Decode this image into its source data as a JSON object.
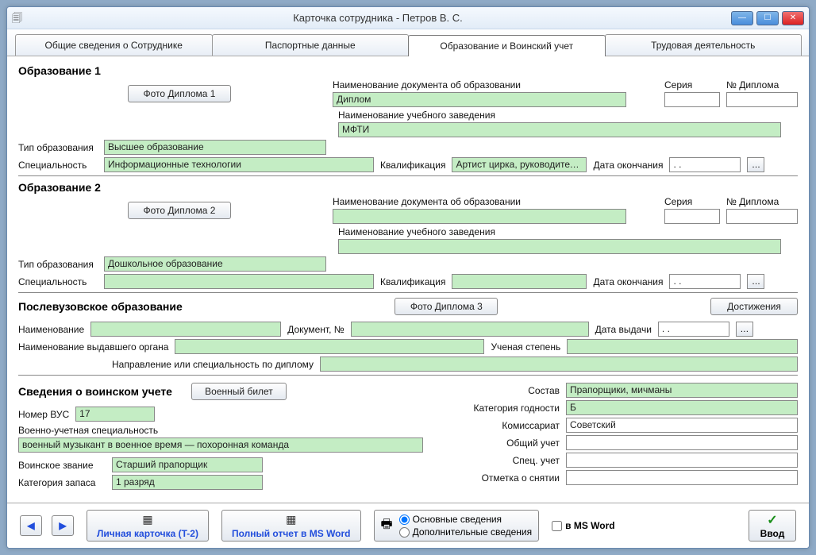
{
  "window": {
    "title": "Карточка сотрудника -  Петров В. С."
  },
  "tabs": {
    "t1": "Общие сведения о Сотруднике",
    "t2": "Паспортные данные",
    "t3": "Образование и Воинский учет",
    "t4": "Трудовая деятельность"
  },
  "edu1": {
    "head": "Образование 1",
    "photo_btn": "Фото Диплома 1",
    "doc_label": "Наименование документа об образовании",
    "doc_value": "Диплом",
    "series_label": "Серия",
    "number_label": "№ Диплома",
    "series_value": "",
    "number_value": "",
    "inst_label": "Наименование учебного заведения",
    "inst_value": "МФТИ",
    "type_label": "Тип образования",
    "type_value": "Высшее образование",
    "spec_label": "Специальность",
    "spec_value": "Информационные технологии",
    "qual_label": "Квалификация",
    "qual_value": "Артист цирка, руководитель и",
    "end_label": "Дата окончания",
    "end_value": " .  ."
  },
  "edu2": {
    "head": "Образование 2",
    "photo_btn": "Фото Диплома 2",
    "doc_label": "Наименование документа об образовании",
    "doc_value": "",
    "series_label": "Серия",
    "number_label": "№ Диплома",
    "series_value": "",
    "number_value": "",
    "inst_label": "Наименование учебного заведения",
    "inst_value": "",
    "type_label": "Тип образования",
    "type_value": "Дошкольное образование",
    "spec_label": "Специальность",
    "spec_value": "",
    "qual_label": "Квалификация",
    "qual_value": "",
    "end_label": "Дата окончания",
    "end_value": " .  ."
  },
  "post": {
    "head": "Послевузовское образование",
    "photo_btn": "Фото Диплома 3",
    "ach_btn": "Достижения",
    "name_label": "Наименование",
    "name_value": "",
    "docnum_label": "Документ, №",
    "docnum_value": "",
    "issue_label": "Дата выдачи",
    "issue_value": " .  .",
    "organ_label": "Наименование выдавшего органа",
    "organ_value": "",
    "degree_label": "Ученая степень",
    "degree_value": "",
    "dir_label": "Направление или специальность по диплому",
    "dir_value": ""
  },
  "mil": {
    "head": "Сведения о воинском учете",
    "ticket_btn": "Военный билет",
    "vus_label": "Номер ВУС",
    "vus_value": "17",
    "vusspec_label": "Военно-учетная специальность",
    "vusspec_value": "военный музыкант в военное время — похоронная команда",
    "rank_label": "Воинское звание",
    "rank_value": "Старший прапорщик",
    "reserve_label": "Категория запаса",
    "reserve_value": "1 разряд",
    "sostav_label": "Состав",
    "sostav_value": "Прапорщики, мичманы",
    "fit_label": "Категория годности",
    "fit_value": "Б",
    "komis_label": "Комиссариат",
    "komis_value": "Советский",
    "gen_label": "Общий учет",
    "gen_value": "",
    "spec_label": "Спец. учет",
    "spec_value": "",
    "mark_label": "Отметка о снятии",
    "mark_value": ""
  },
  "footer": {
    "card_btn": "Личная карточка (T-2)",
    "report_btn": "Полный отчет в MS Word",
    "opt1": "Основные сведения",
    "opt2": "Дополнительные сведения",
    "msword": "в MS Word",
    "enter": "Ввод"
  }
}
